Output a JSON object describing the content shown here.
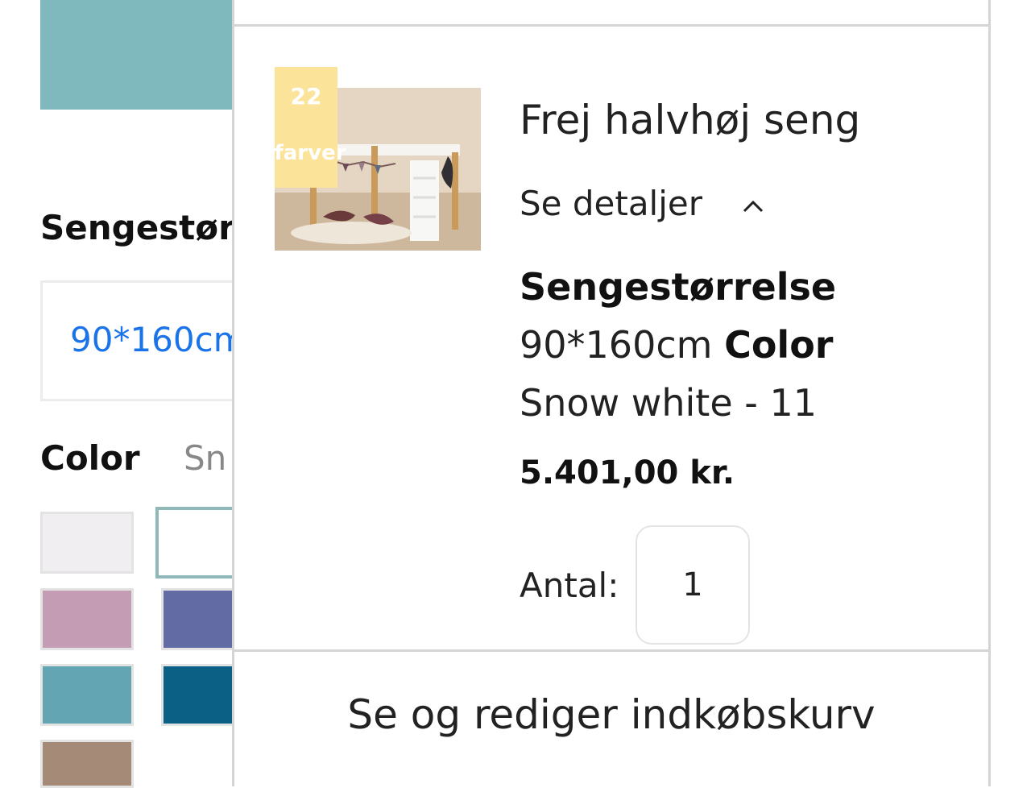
{
  "background_page": {
    "size_label": "Sengestør",
    "size_value": "90*160cm",
    "color_label": "Color",
    "color_value": "Sn",
    "accent_color": "#7fb9be",
    "swatch_colors": [
      "#f1eef1",
      "#ffffff",
      "#c49db5",
      "#626ba3",
      "#64a5b3",
      "#0b6185",
      "#a68a78"
    ]
  },
  "popup": {
    "badge": {
      "number": "22",
      "label": "farver"
    },
    "product_title": "Frej halvhøj seng",
    "details_toggle": "Se detaljer",
    "attributes": {
      "size_label": "Sengestørrelse",
      "size_value": "90*160cm",
      "color_label": "Color",
      "color_value": "Snow white - 11"
    },
    "price": "5.401,00 kr.",
    "quantity_label": "Antal:",
    "quantity_value": "1",
    "cart_link": "Se og rediger indkøbskurv"
  }
}
